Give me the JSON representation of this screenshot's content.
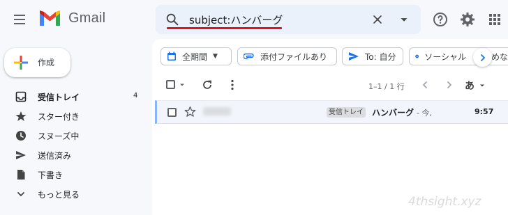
{
  "header": {
    "app_name": "Gmail",
    "search_value": "subject:ハンバーグ"
  },
  "sidebar": {
    "compose_label": "作成",
    "items": [
      {
        "label": "受信トレイ",
        "count": "4",
        "icon": "inbox-icon"
      },
      {
        "label": "スター付き",
        "icon": "star-icon"
      },
      {
        "label": "スヌーズ中",
        "icon": "clock-icon"
      },
      {
        "label": "送信済み",
        "icon": "send-icon"
      },
      {
        "label": "下書き",
        "icon": "draft-icon"
      },
      {
        "label": "もっと見る",
        "icon": "chevron-down-icon"
      }
    ]
  },
  "filters": [
    {
      "label": "全期間",
      "icon": "calendar-icon",
      "dropdown": true
    },
    {
      "label": "添付ファイルあり",
      "icon": "attachment-icon"
    },
    {
      "label": "To: 自分",
      "icon": "send-icon"
    },
    {
      "label": "ソーシャル",
      "icon": "social-icon"
    },
    {
      "label": "めな",
      "icon": ""
    }
  ],
  "toolbar": {
    "page_range": "1–1 / 1 行",
    "input_tools_label": "あ"
  },
  "messages": [
    {
      "label_badge": "受信トレイ",
      "subject": "ハンバーグ",
      "snippet": "- 今,",
      "time": "9:57"
    }
  ],
  "watermark": "4thsight.xyz",
  "colors": {
    "accent": "#1a73e8",
    "search_bg": "#eaf1fb",
    "highlight_underline": "#e8101a",
    "row_selected_border": "#8ab4f8"
  }
}
